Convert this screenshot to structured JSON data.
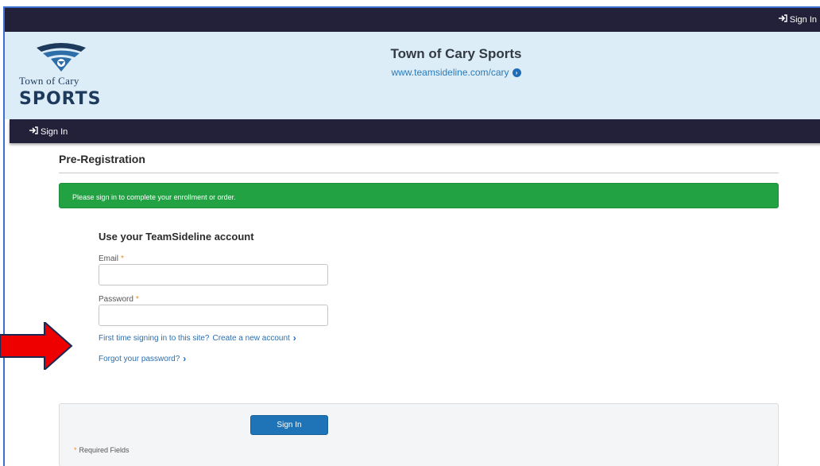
{
  "topbar": {
    "signin_label": "Sign In"
  },
  "header": {
    "logo_town": "Town of Cary",
    "logo_sports": "SPORTS",
    "title": "Town of Cary Sports",
    "url": "www.teamsideline.com/cary"
  },
  "navbar": {
    "signin_label": "Sign In"
  },
  "page": {
    "title": "Pre-Registration",
    "alert": "Please sign in to complete your enrollment or order."
  },
  "form": {
    "heading": "Use your TeamSideline account",
    "email_label": "Email",
    "email_value": "",
    "password_label": "Password",
    "password_value": "",
    "required_mark": "*",
    "create_prefix": "First time signing in to this site?",
    "create_link": "Create a new account",
    "forgot_link": "Forgot your password?",
    "submit_label": "Sign In",
    "required_note": "Required Fields"
  },
  "colors": {
    "dark_bar": "#23203a",
    "header_bg": "#dcedf8",
    "alert_green": "#22a243",
    "primary_button": "#1f74b8",
    "link_blue": "#2a6fb0",
    "required_orange": "#f08a24",
    "annotation_arrow": "#ee0000"
  },
  "icons": {
    "signin": "sign-in-icon",
    "url_chevron": "circle-chevron-right-icon",
    "link_chevron": "chevron-right-icon",
    "annotation": "red-arrow-annotation"
  }
}
